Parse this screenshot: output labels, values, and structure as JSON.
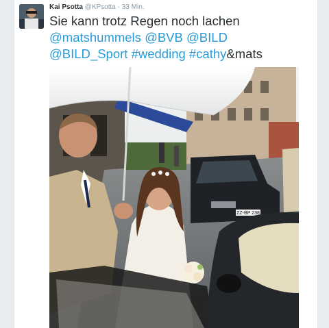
{
  "tweet": {
    "author_name": "Kai Psotta",
    "handle": "@KPsotta",
    "separator": " · ",
    "time": "33 Min.",
    "text": {
      "plain1": "Sie kann trotz Regen noch lachen",
      "mention1": "@matshummels",
      "mention2": "@BVB",
      "mention3": "@BILD",
      "mention4": "@BILD_Sport",
      "hashtag1": "#wedding",
      "hashtag2": "#cathy",
      "plain2": "&mats"
    }
  },
  "photo": {
    "license_plate": "ZZ-BP 238"
  },
  "colors": {
    "link": "#2a9bd8",
    "name": "#292f33",
    "meta": "#8899a6"
  }
}
